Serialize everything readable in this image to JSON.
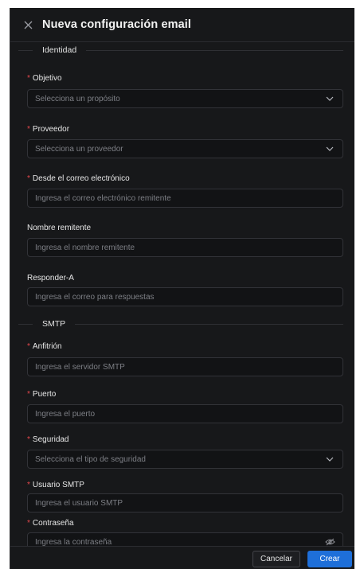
{
  "dialog": {
    "title": "Nueva configuración email",
    "required_marker": "*"
  },
  "sections": {
    "identity": "Identidad",
    "smtp": "SMTP"
  },
  "fields": {
    "objetivo": {
      "label": "Objetivo",
      "placeholder": "Selecciona un propósito",
      "required": true,
      "type": "select"
    },
    "proveedor": {
      "label": "Proveedor",
      "placeholder": "Selecciona un proveedor",
      "required": true,
      "type": "select"
    },
    "desde": {
      "label": "Desde el correo electrónico",
      "placeholder": "Ingresa el correo electrónico remitente",
      "required": true,
      "type": "text"
    },
    "nombre": {
      "label": "Nombre remitente",
      "placeholder": "Ingresa el nombre remitente",
      "required": false,
      "type": "text"
    },
    "responder": {
      "label": "Responder-A",
      "placeholder": "Ingresa el correo para respuestas",
      "required": false,
      "type": "text"
    },
    "anfitrion": {
      "label": "Anfitrión",
      "placeholder": "Ingresa el servidor SMTP",
      "required": true,
      "type": "text"
    },
    "puerto": {
      "label": "Puerto",
      "placeholder": "Ingresa el puerto",
      "required": true,
      "type": "text"
    },
    "seguridad": {
      "label": "Seguridad",
      "placeholder": "Selecciona el tipo de seguridad",
      "required": true,
      "type": "select"
    },
    "usuario": {
      "label": "Usuario SMTP",
      "placeholder": "Ingresa el usuario SMTP",
      "required": true,
      "type": "text"
    },
    "contrasena": {
      "label": "Contraseña",
      "placeholder": "Ingresa la contraseña",
      "required": true,
      "type": "password"
    }
  },
  "footer": {
    "cancel_label": "Cancelar",
    "create_label": "Crear"
  },
  "icons": {
    "close": "close-icon",
    "chevron": "chevron-down-icon",
    "eye_off": "eye-off-icon"
  },
  "colors": {
    "background": "#17181a",
    "input_background": "#121315",
    "required": "#e5484d",
    "primary": "#1e6fd9"
  }
}
